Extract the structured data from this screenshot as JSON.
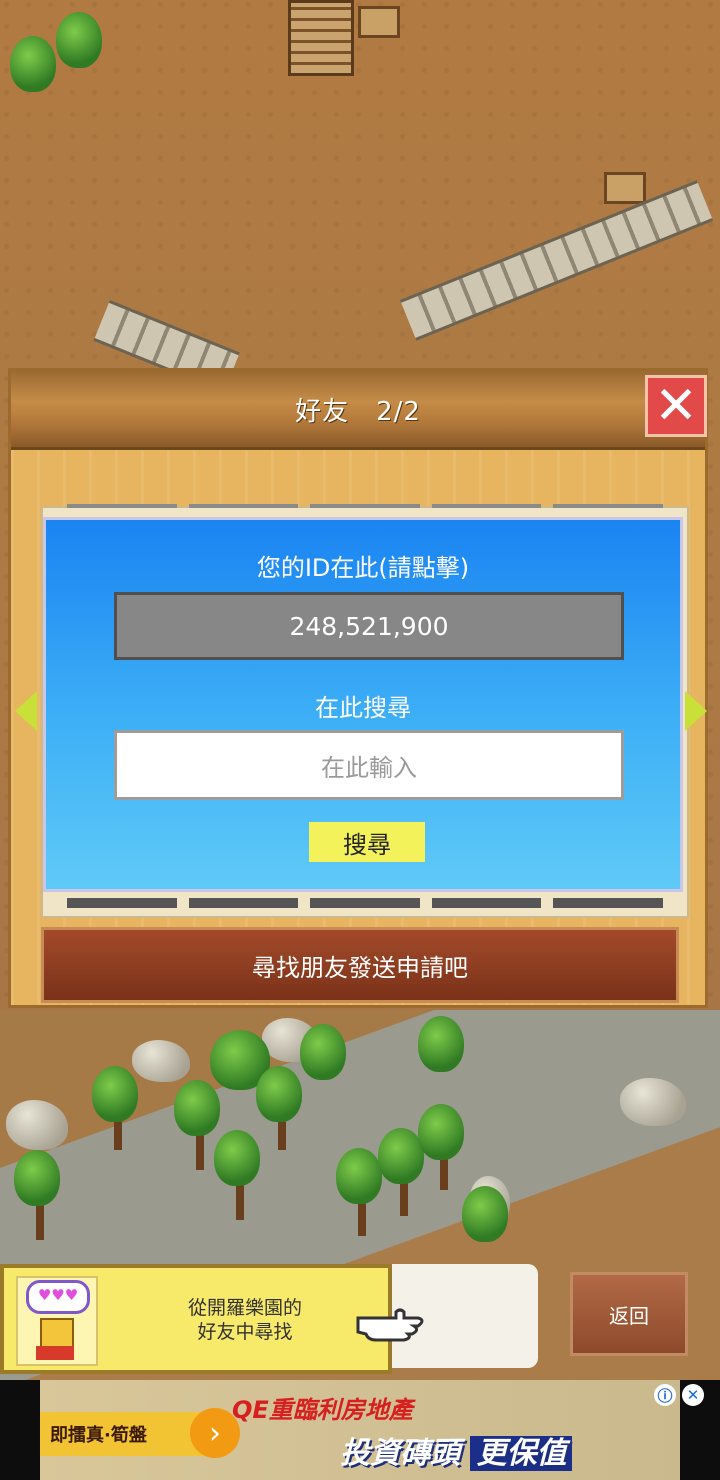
{
  "dialog": {
    "title": "好友　2/2",
    "close_icon": "close-icon"
  },
  "panel": {
    "id_label": "您的ID在此(請點擊)",
    "id_value": "248,521,900",
    "search_label": "在此搜尋",
    "search_placeholder": "在此輸入",
    "search_button": "搜尋"
  },
  "friend_request_button": "尋找朋友發送申請吧",
  "tip": {
    "line1": "從開羅樂園的",
    "line2": "好友中尋找",
    "bubble": "♥♥♥"
  },
  "back_button": "返回",
  "ad": {
    "left_text": "即擂真·筍盤",
    "headline": "QE重臨利房地產",
    "subline_a": "投資磚頭",
    "subline_b": "更保值",
    "info_icon": "ⓘ",
    "close_icon": "✕"
  },
  "colors": {
    "panel_blue": "#1a84f2",
    "close_red": "#e24a4a",
    "search_yellow": "#f4f25a",
    "request_brown": "#7a3219"
  }
}
